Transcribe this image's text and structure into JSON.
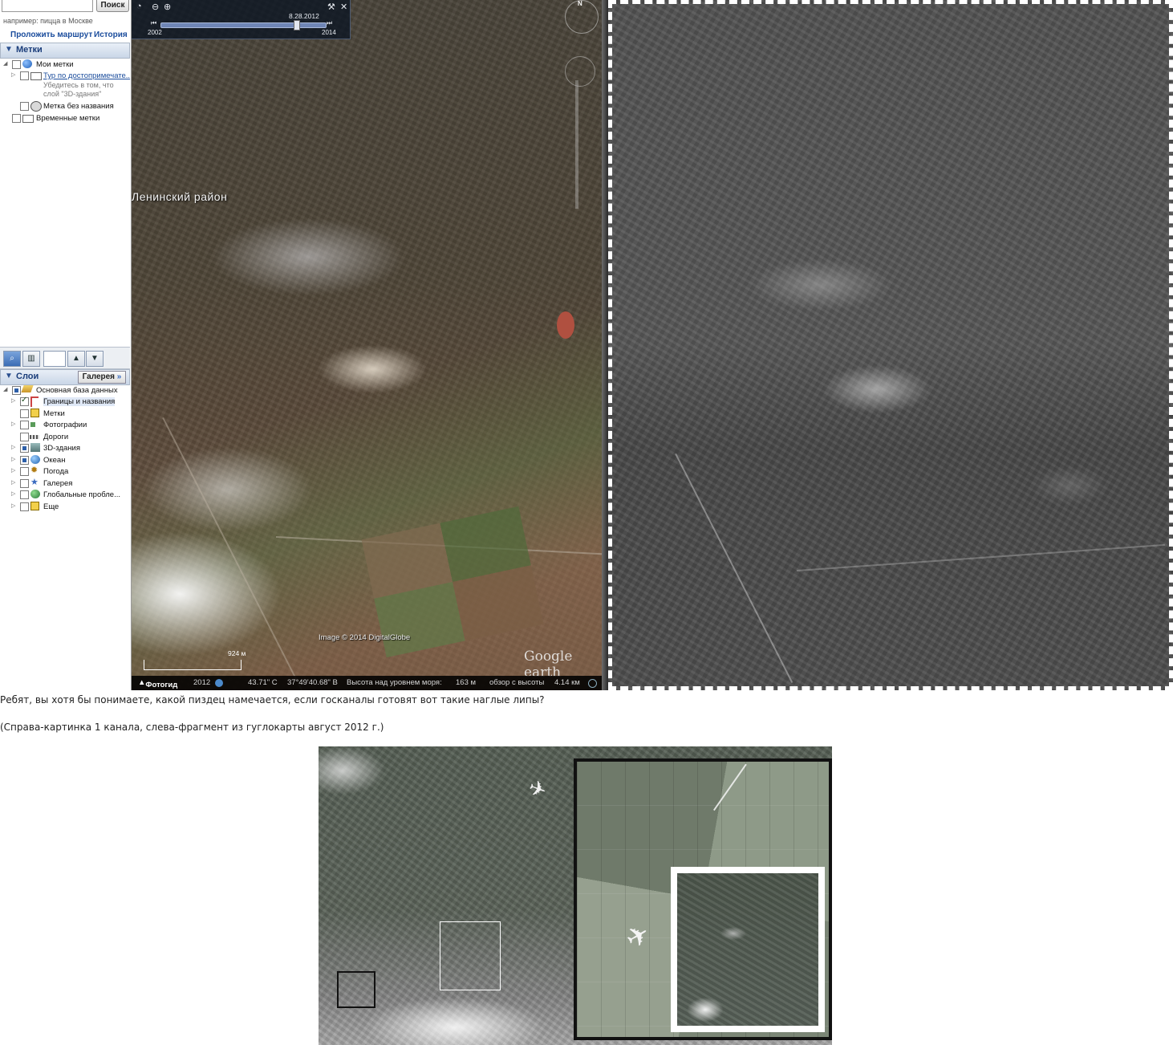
{
  "search": {
    "button_label": "Поиск",
    "hint": "например: пицца в Москве",
    "route_link": "Проложить маршрут",
    "history_link": "История"
  },
  "places": {
    "title": "Метки",
    "items": [
      {
        "label": "Мои метки"
      },
      {
        "label": "Тур по достопримечате.."
      },
      {
        "label": "Метка без названия"
      },
      {
        "label": "Временные метки"
      }
    ],
    "note": "Убедитесь в том, что слой \"3D-здания\""
  },
  "layers": {
    "title": "Слои",
    "gallery_button": "Галерея",
    "items": [
      {
        "label": "Основная база данных"
      },
      {
        "label": "Границы и названия"
      },
      {
        "label": "Метки"
      },
      {
        "label": "Фотографии"
      },
      {
        "label": "Дороги"
      },
      {
        "label": "3D-здания"
      },
      {
        "label": "Океан"
      },
      {
        "label": "Погода"
      },
      {
        "label": "Галерея"
      },
      {
        "label": "Глобальные пробле..."
      },
      {
        "label": "Еще"
      }
    ]
  },
  "timeline": {
    "date": "8.28.2012",
    "start": "2002",
    "end": "2014"
  },
  "map": {
    "district": "Ленинский район",
    "copyright": "Image © 2014 DigitalGlobe",
    "logo": "Google earth",
    "scale": "924 м",
    "compass_n": "N"
  },
  "status": {
    "tour_guide": "Фотогид",
    "year": "2012",
    "coords": "43.71\" С",
    "lon": "37°49'40.68\" В",
    "elev_label": "Высота над уровнем моря:",
    "elev_value": "163 м",
    "view_label": "обзор с высоты",
    "view_value": "4.14 км"
  },
  "captions": {
    "line1": "Ребят, вы хотя бы понимаете, какой пиздец намечается, если госканалы готовят вот такие наглые липы?",
    "line2": "(Справа-картинка 1 канала, слева-фрагмент из гуглокарты август 2012 г.)"
  },
  "colors": {
    "link": "#1a4c9c",
    "panel_head": "#c9d6e7",
    "status_bg": "#000000"
  }
}
